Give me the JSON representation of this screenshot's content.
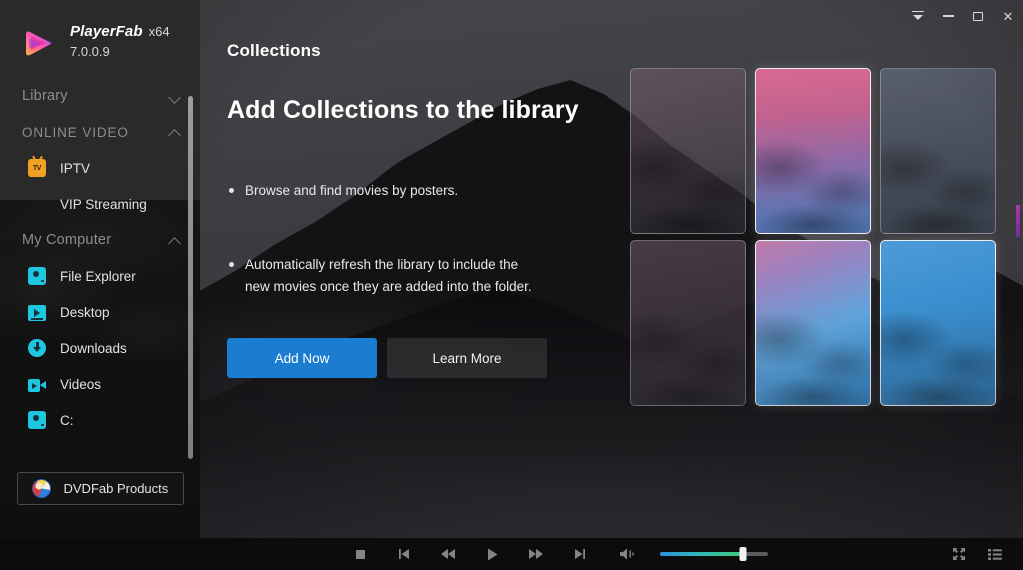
{
  "window": {
    "controls": [
      {
        "name": "collapse",
        "label": "⌄",
        "icon": "collapse-icon"
      },
      {
        "name": "minimize",
        "label": "–",
        "icon": "minimize-icon"
      },
      {
        "name": "maximize",
        "label": "□",
        "icon": "maximize-icon"
      },
      {
        "name": "close",
        "label": "✕",
        "icon": "close-icon"
      }
    ]
  },
  "brand": {
    "name": "PlayerFab",
    "arch": "x64",
    "version": "7.0.0.9",
    "logo_icon": "playerfab-play-logo-icon",
    "logo_colors": [
      "#ff8a1e",
      "#f0309a",
      "#a03ce0",
      "#5a5ae0"
    ]
  },
  "sidebar": {
    "sections": [
      {
        "id": "library",
        "label": "Library",
        "expanded": false,
        "chevron": "chevron-down-icon",
        "items": []
      },
      {
        "id": "online-video",
        "label": "ONLINE VIDEO",
        "expanded": true,
        "chevron": "chevron-up-icon",
        "items": [
          {
            "label": "IPTV",
            "icon": "tv-icon",
            "icon_color": "#f0a022",
            "icon_text": "TV"
          },
          {
            "label": "VIP Streaming",
            "icon": "vip-crown-icon",
            "icon_color": "#f3c330"
          }
        ]
      },
      {
        "id": "my-computer",
        "label": "My Computer",
        "expanded": true,
        "chevron": "chevron-up-icon",
        "items": [
          {
            "label": "File Explorer",
            "icon": "disc-icon",
            "icon_color": "#1ec6e0"
          },
          {
            "label": "Desktop",
            "icon": "monitor-play-icon",
            "icon_color": "#1ec6e0"
          },
          {
            "label": "Downloads",
            "icon": "download-circle-icon",
            "icon_color": "#1ec6e0"
          },
          {
            "label": "Videos",
            "icon": "video-camera-icon",
            "icon_color": "#1ec6e0"
          },
          {
            "label": "C:",
            "icon": "disc-icon",
            "icon_color": "#1ec6e0"
          }
        ]
      }
    ],
    "footer_button": {
      "label": "DVDFab Products",
      "icon": "dvdfab-logo-icon"
    },
    "scrollbar": {
      "thumb_top_pct": 0,
      "thumb_height_pct": 98
    }
  },
  "main": {
    "page_title": "Collections",
    "headline": "Add Collections to the library",
    "bullets": [
      "Browse and find movies by posters.",
      "Automatically refresh the library to include the\nnew movies once they are added into the folder."
    ],
    "buttons": {
      "primary": {
        "label": "Add Now",
        "color": "#1a7dd1"
      },
      "secondary": {
        "label": "Learn More"
      }
    },
    "posters": [
      {
        "id": "poster-1",
        "highlighted": false,
        "palette": "muted-mauve"
      },
      {
        "id": "poster-2",
        "highlighted": true,
        "palette": "pink-to-blue"
      },
      {
        "id": "poster-3",
        "highlighted": false,
        "palette": "muted-steel"
      },
      {
        "id": "poster-4",
        "highlighted": false,
        "palette": "muted-rose"
      },
      {
        "id": "poster-5",
        "highlighted": true,
        "palette": "violet-to-cyan"
      },
      {
        "id": "poster-6",
        "highlighted": true,
        "palette": "blue"
      }
    ]
  },
  "player": {
    "transport": [
      {
        "name": "stop-button",
        "icon": "stop-icon"
      },
      {
        "name": "previous-button",
        "icon": "previous-track-icon"
      },
      {
        "name": "rewind-button",
        "icon": "rewind-icon"
      },
      {
        "name": "play-button",
        "icon": "play-icon"
      },
      {
        "name": "fast-forward-button",
        "icon": "fast-forward-icon"
      },
      {
        "name": "next-button",
        "icon": "next-track-icon"
      }
    ],
    "volume": {
      "icon": "volume-icon",
      "value_pct": 77,
      "fill_gradient": [
        "#2f8fd8",
        "#3ecb7a"
      ]
    },
    "right_controls": [
      {
        "name": "fullscreen-button",
        "icon": "fullscreen-icon"
      },
      {
        "name": "playlist-button",
        "icon": "playlist-icon"
      }
    ]
  },
  "theme": {
    "sidebar_bg": "#2a2a2a",
    "player_bar_bg": "#0c0c0c",
    "accent_blue": "#1a7dd1",
    "accent_cyan": "#1ec6e0",
    "accent_orange": "#f0a022"
  }
}
